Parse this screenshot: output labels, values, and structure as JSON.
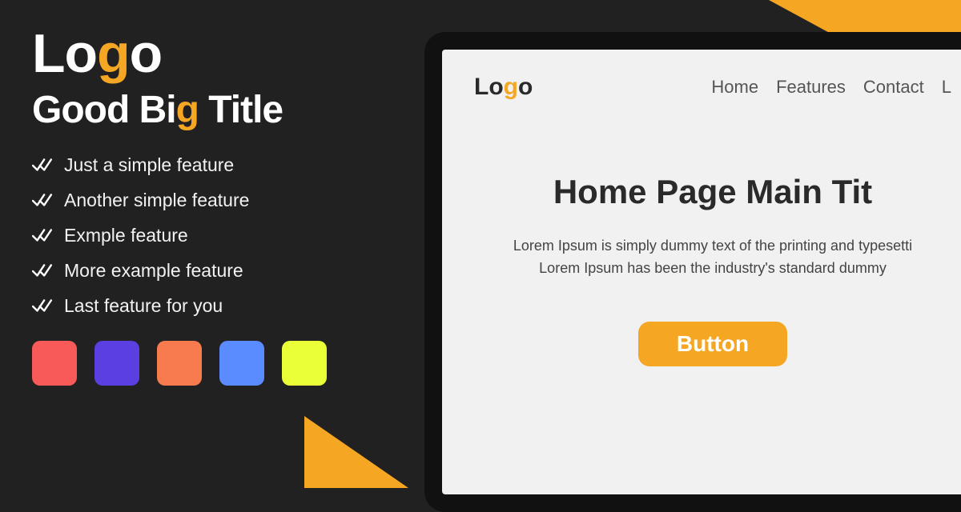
{
  "left": {
    "logo_prefix": "Lo",
    "logo_g": "g",
    "logo_suffix": "o",
    "title_part1": "Good Bi",
    "title_g": "g",
    "title_part2": " Title",
    "features": [
      "Just a simple feature",
      "Another simple feature",
      "Exmple feature",
      "More example feature",
      "Last feature for you"
    ],
    "swatches": [
      "#f85a5a",
      "#5b3fe0",
      "#f77b4f",
      "#5a8cff",
      "#ebff38"
    ]
  },
  "mock": {
    "logo_prefix": "Lo",
    "logo_g": "g",
    "logo_suffix": "o",
    "nav": [
      "Home",
      "Features",
      "Contact",
      "L"
    ],
    "title": "Home Page Main Tit",
    "desc_line1": "Lorem Ipsum is simply dummy text of the printing and typesetti",
    "desc_line2": "Lorem Ipsum has been the industry's standard dummy",
    "button": "Button"
  }
}
